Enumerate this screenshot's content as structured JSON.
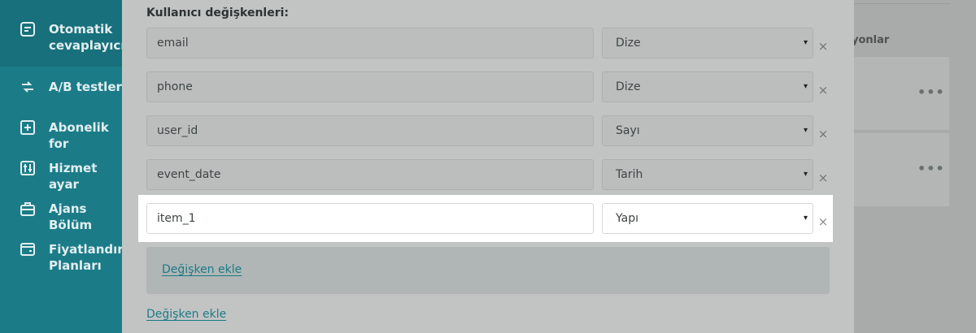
{
  "sidebar": {
    "items": [
      {
        "label": "Otomatik\ncevaplayıcıla",
        "icon": "autoresponder-icon",
        "active": true
      },
      {
        "label": "A/B testleri",
        "icon": "ab-test-icon"
      },
      {
        "label": "Abonelik for",
        "icon": "subscription-form-icon"
      },
      {
        "label": "Hizmet ayar",
        "icon": "service-settings-icon"
      },
      {
        "label": "Ajans Bölüm",
        "icon": "agency-icon"
      },
      {
        "label": "Fiyatlandırm\nPlanları",
        "icon": "pricing-icon"
      }
    ]
  },
  "background": {
    "column_header": "yonlar",
    "card_menu": "•••"
  },
  "modal": {
    "section_label": "Kullanıcı değişkenleri:",
    "rows": [
      {
        "name": "email",
        "type": "Dize"
      },
      {
        "name": "phone",
        "type": "Dize"
      },
      {
        "name": "user_id",
        "type": "Sayı"
      },
      {
        "name": "event_date",
        "type": "Tarih"
      },
      {
        "name": "item_1",
        "type": "Yapı",
        "highlighted": true
      }
    ],
    "remove_symbol": "×",
    "select_caret": "▾",
    "add_inner_label": "Değişken ekle",
    "add_outer_label": "Değişken ekle"
  },
  "colors": {
    "sidebar": "#1b7c88",
    "link": "#1d7a85",
    "overlay": "#8a8c8c"
  }
}
